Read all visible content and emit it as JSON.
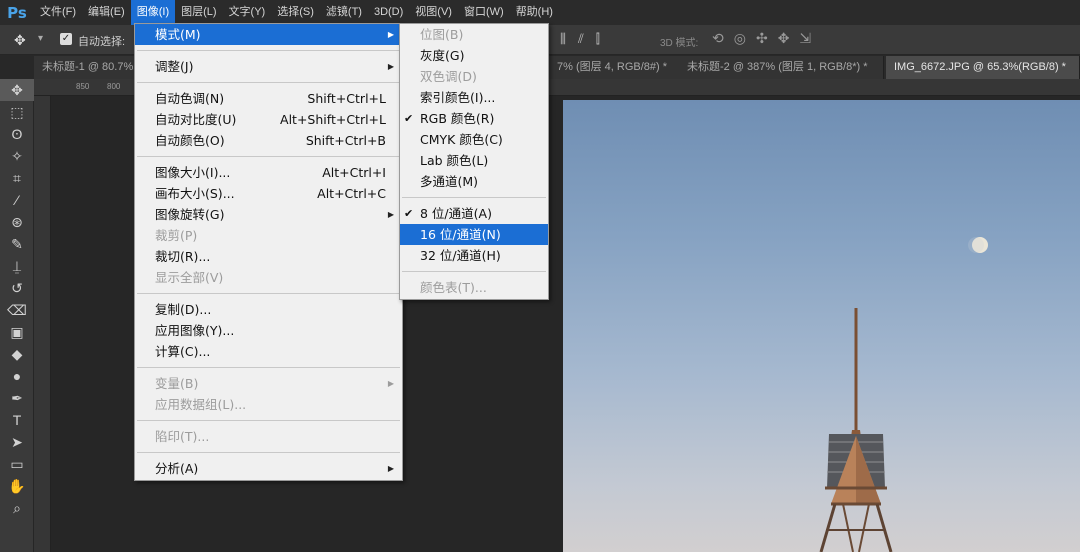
{
  "app": {
    "logo": "Ps"
  },
  "menubar": {
    "items": [
      "文件(F)",
      "编辑(E)",
      "图像(I)",
      "图层(L)",
      "文字(Y)",
      "选择(S)",
      "滤镜(T)",
      "3D(D)",
      "视图(V)",
      "窗口(W)",
      "帮助(H)"
    ],
    "active_index": 2
  },
  "options": {
    "auto_select_label": "自动选择:",
    "mode_3d_label": "3D 模式:"
  },
  "tabs": [
    "未标题-1 @ 80.7%",
    "7% (图层 4, RGB/8#) *",
    "未标题-2 @ 387% (图层 1, RGB/8*) *",
    "IMG_6672.JPG @ 65.3%(RGB/8) *"
  ],
  "ruler": {
    "marks": [
      "850",
      "800"
    ]
  },
  "image_menu": {
    "mode": "模式(M)",
    "adjust": "调整(J)",
    "auto_tone": "自动色调(N)",
    "auto_tone_sc": "Shift+Ctrl+L",
    "auto_contrast": "自动对比度(U)",
    "auto_contrast_sc": "Alt+Shift+Ctrl+L",
    "auto_color": "自动颜色(O)",
    "auto_color_sc": "Shift+Ctrl+B",
    "image_size": "图像大小(I)...",
    "image_size_sc": "Alt+Ctrl+I",
    "canvas_size": "画布大小(S)...",
    "canvas_size_sc": "Alt+Ctrl+C",
    "image_rotation": "图像旋转(G)",
    "crop": "裁剪(P)",
    "trim": "裁切(R)...",
    "reveal_all": "显示全部(V)",
    "duplicate": "复制(D)...",
    "apply_image": "应用图像(Y)...",
    "calculations": "计算(C)...",
    "variables": "变量(B)",
    "apply_data_set": "应用数据组(L)...",
    "trap": "陷印(T)...",
    "analysis": "分析(A)"
  },
  "mode_menu": {
    "bitmap": "位图(B)",
    "grayscale": "灰度(G)",
    "duotone": "双色调(D)",
    "indexed": "索引颜色(I)...",
    "rgb": "RGB 颜色(R)",
    "cmyk": "CMYK 颜色(C)",
    "lab": "Lab 颜色(L)",
    "multichannel": "多通道(M)",
    "bits8": "8 位/通道(A)",
    "bits16": "16 位/通道(N)",
    "bits32": "32 位/通道(H)",
    "color_table": "颜色表(T)..."
  },
  "colors": {
    "accent": "#1b6ed4",
    "menu_bg": "#f0f0f0",
    "chrome": "#3a3a3a"
  }
}
